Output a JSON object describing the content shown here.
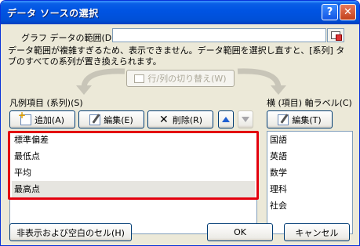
{
  "window": {
    "title": "データ ソースの選択",
    "help_label": "?",
    "close_label": "✕"
  },
  "range": {
    "label": "グラフ データの範囲(D):",
    "value": ""
  },
  "message": "データ範囲が複雑すぎるため、表示できません。データ範囲を選択し直すと、[系列] タブのすべての系列が置き換えられます。",
  "switch_button": "行/列の切り替え(W)",
  "legend": {
    "label": "凡例項目 (系列)(S)",
    "add": "追加(A)",
    "edit": "編集(E)",
    "delete": "削除(R)",
    "delete_icon": "✕",
    "items": [
      "標準偏差",
      "最低点",
      "平均",
      "最高点"
    ],
    "selected_index": 3
  },
  "axis": {
    "label": "横 (項目) 軸ラベル(C)",
    "edit": "編集(T)",
    "items": [
      "国語",
      "英語",
      "数学",
      "理科",
      "社会"
    ]
  },
  "footer": {
    "hidden_cells": "非表示および空白のセル(H)",
    "ok": "OK",
    "cancel": "キャンセル"
  },
  "colors": {
    "titlebar": "#0054e3",
    "highlight": "#e3000e",
    "dialog_bg": "#ece9d8"
  }
}
